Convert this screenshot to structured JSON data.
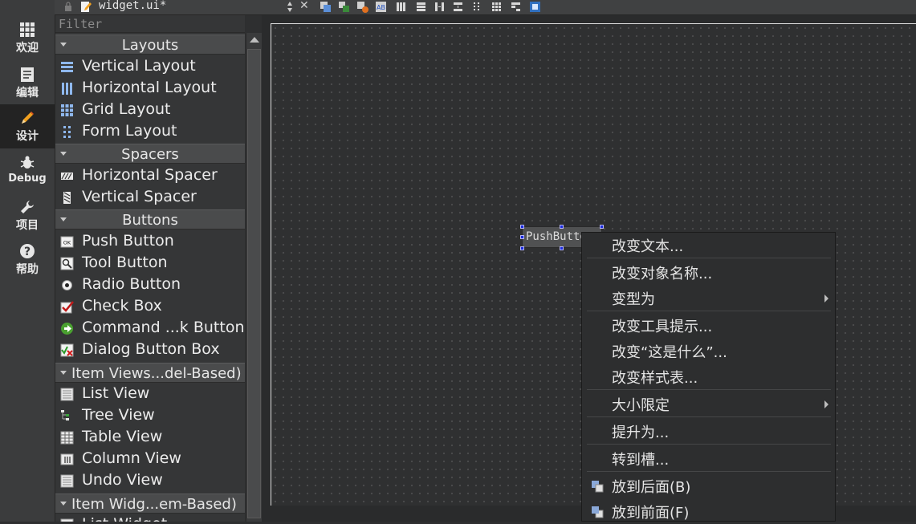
{
  "modes": [
    {
      "label": "欢迎",
      "icon": "welcome-grid-icon"
    },
    {
      "label": "编辑",
      "icon": "edit-document-icon"
    },
    {
      "label": "设计",
      "icon": "design-pencil-icon"
    },
    {
      "label": "Debug",
      "icon": "debug-bug-icon"
    },
    {
      "label": "项目",
      "icon": "project-wrench-icon"
    },
    {
      "label": "帮助",
      "icon": "help-question-icon"
    }
  ],
  "topbar": {
    "file_title": "widget.ui*",
    "close_glyph": "✕"
  },
  "widgetbox": {
    "filter_placeholder": "Filter",
    "categories": [
      {
        "label": "Layouts",
        "items": [
          {
            "label": "Vertical Layout",
            "icon": "vertical-layout-icon"
          },
          {
            "label": "Horizontal Layout",
            "icon": "horizontal-layout-icon"
          },
          {
            "label": "Grid Layout",
            "icon": "grid-layout-icon"
          },
          {
            "label": "Form Layout",
            "icon": "form-layout-icon"
          }
        ]
      },
      {
        "label": "Spacers",
        "items": [
          {
            "label": "Horizontal Spacer",
            "icon": "horizontal-spacer-icon"
          },
          {
            "label": "Vertical Spacer",
            "icon": "vertical-spacer-icon"
          }
        ]
      },
      {
        "label": "Buttons",
        "items": [
          {
            "label": "Push Button",
            "icon": "push-button-icon"
          },
          {
            "label": "Tool Button",
            "icon": "tool-button-icon"
          },
          {
            "label": "Radio Button",
            "icon": "radio-button-icon"
          },
          {
            "label": "Check Box",
            "icon": "check-box-icon"
          },
          {
            "label": "Command ...k Button",
            "icon": "command-link-button-icon"
          },
          {
            "label": "Dialog Button Box",
            "icon": "dialog-button-box-icon"
          }
        ]
      },
      {
        "label": "Item Views...del-Based)",
        "items": [
          {
            "label": "List View",
            "icon": "list-view-icon"
          },
          {
            "label": "Tree View",
            "icon": "tree-view-icon"
          },
          {
            "label": "Table View",
            "icon": "table-view-icon"
          },
          {
            "label": "Column View",
            "icon": "column-view-icon"
          },
          {
            "label": "Undo View",
            "icon": "undo-view-icon"
          }
        ]
      },
      {
        "label": "Item Widg...em-Based)",
        "items": [
          {
            "label": "List Widget",
            "icon": "list-widget-icon"
          }
        ]
      }
    ]
  },
  "form": {
    "push_button_text": "PushButton"
  },
  "context_menu": {
    "items": [
      {
        "label": "改变文本..."
      },
      {
        "label": "改变对象名称..."
      },
      {
        "label": "变型为",
        "submenu": true
      },
      {
        "label": "改变工具提示..."
      },
      {
        "label": "改变“这是什么”..."
      },
      {
        "label": "改变样式表..."
      },
      {
        "label": "大小限定",
        "submenu": true
      },
      {
        "label": "提升为..."
      },
      {
        "label": "转到槽..."
      },
      {
        "label": "放到后面(B)",
        "icon": "send-to-back-icon"
      },
      {
        "label": "放到前面(F)",
        "icon": "bring-to-front-icon"
      }
    ]
  },
  "colors": {
    "accent_selection": "#1b2ddc",
    "menu_bg": "#2d2e2f",
    "category_bg": "#4a4b4c"
  }
}
